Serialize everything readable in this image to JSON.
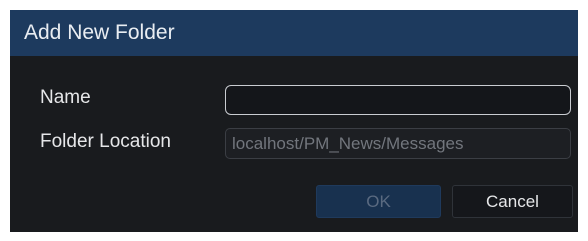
{
  "dialog": {
    "title": "Add New Folder",
    "name_label": "Name",
    "name_value": "",
    "location_label": "Folder Location",
    "location_value": "localhost/PM_News/Messages",
    "ok_label": "OK",
    "cancel_label": "Cancel"
  },
  "colors": {
    "title_bar": "#1d3a5e",
    "dialog_background": "#191b1e",
    "ok_button_disabled": "#18314f"
  }
}
